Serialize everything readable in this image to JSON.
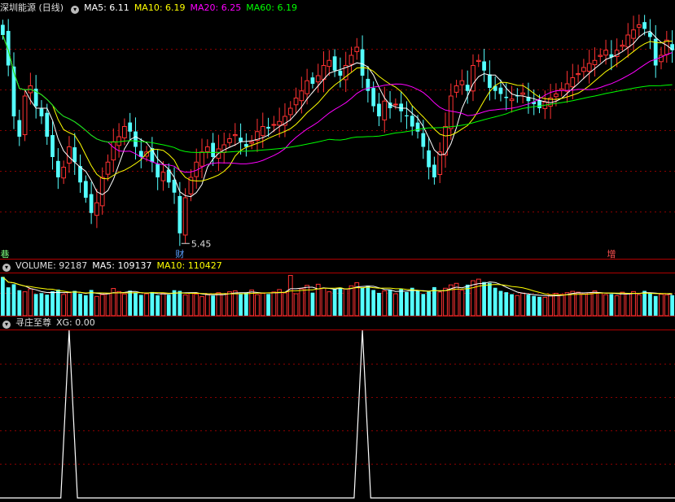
{
  "header": {
    "title": "深圳能源 (日线)",
    "ma5_label": "MA5: 6.11",
    "ma10_label": "MA10: 6.19",
    "ma20_label": "MA20: 6.25",
    "ma60_label": "MA60: 6.19"
  },
  "volume_header": {
    "title": "VOLUME: 92187",
    "ma5_label": "MA5: 109137",
    "ma10_label": "MA10: 110427"
  },
  "indicator_header": {
    "title": "寻庄至尊",
    "xg_label": "XG: 0.00"
  },
  "colors": {
    "up": "#ff3232",
    "down": "#54ffff",
    "ma5": "#ffffff",
    "ma10": "#ffff00",
    "ma20": "#ff00ff",
    "ma60": "#00ff00",
    "grid": "#8b0000",
    "background": "#000000"
  },
  "chart_data": [
    {
      "type": "candlestick",
      "low_marker": {
        "label": "5.45",
        "value": 5.45
      },
      "event_markers": [
        {
          "label": "巷",
          "index": 0
        },
        {
          "label": "财",
          "index": 32
        },
        {
          "label": "增",
          "index": 110
        }
      ],
      "ylim": [
        5.3,
        7.7
      ],
      "close": [
        7.5,
        7.2,
        6.7,
        6.5,
        6.9,
        7.0,
        6.8,
        6.7,
        6.5,
        6.3,
        6.1,
        6.2,
        6.4,
        6.25,
        6.05,
        5.9,
        5.75,
        5.85,
        6.1,
        6.25,
        6.45,
        6.5,
        6.6,
        6.55,
        6.4,
        6.3,
        6.35,
        6.25,
        6.1,
        6.15,
        6.05,
        5.95,
        5.55,
        5.9,
        6.1,
        6.25,
        6.35,
        6.4,
        6.3,
        6.38,
        6.42,
        6.48,
        6.52,
        6.45,
        6.4,
        6.45,
        6.55,
        6.6,
        6.58,
        6.62,
        6.65,
        6.7,
        6.78,
        6.88,
        6.95,
        7.05,
        7.02,
        7.1,
        7.2,
        7.25,
        7.15,
        7.1,
        7.2,
        7.3,
        7.38,
        7.1,
        6.95,
        6.8,
        6.7,
        6.85,
        6.78,
        6.82,
        6.75,
        6.7,
        6.6,
        6.55,
        6.4,
        6.2,
        6.1,
        6.35,
        6.6,
        6.9,
        7.0,
        7.05,
        6.95,
        7.2,
        7.25,
        7.15,
        6.98,
        6.95,
        6.92,
        6.88,
        6.87,
        6.9,
        6.93,
        6.85,
        6.82,
        6.78,
        6.84,
        6.88,
        6.92,
        6.97,
        7.02,
        7.08,
        7.12,
        7.18,
        7.22,
        7.25,
        7.3,
        7.35,
        7.28,
        7.35,
        7.4,
        7.5,
        7.55,
        7.6,
        7.56,
        7.48,
        7.2,
        7.3,
        7.45,
        7.35
      ],
      "volume": [
        175000,
        128000,
        142000,
        115000,
        108000,
        121000,
        98000,
        102000,
        95000,
        110000,
        118000,
        96000,
        104000,
        112000,
        99000,
        92000,
        116000,
        87000,
        95000,
        101000,
        123000,
        109000,
        98000,
        113000,
        105000,
        94000,
        99000,
        107000,
        92000,
        101000,
        95000,
        115000,
        112000,
        94000,
        103000,
        98000,
        86000,
        95000,
        91000,
        104000,
        99000,
        108000,
        112000,
        97000,
        104000,
        116000,
        95000,
        101000,
        98000,
        107000,
        118000,
        103000,
        182000,
        99000,
        121000,
        137000,
        104000,
        142000,
        125000,
        108000,
        119000,
        127000,
        121000,
        135000,
        149000,
        127000,
        136000,
        116000,
        103000,
        112000,
        118000,
        99000,
        121000,
        107000,
        126000,
        113000,
        98000,
        109000,
        129000,
        107000,
        124000,
        139000,
        146000,
        115000,
        140000,
        158000,
        165000,
        152000,
        148000,
        126000,
        112000,
        106000,
        97000,
        91000,
        102000,
        95000,
        89000,
        85000,
        83000,
        93000,
        101000,
        96000,
        104000,
        110000,
        106000,
        98000,
        103000,
        112000,
        102000,
        95000,
        98000,
        90000,
        106000,
        99000,
        109000,
        95000,
        112000,
        104000,
        89000,
        97000,
        94000,
        92187
      ]
    },
    {
      "type": "line",
      "series": [
        {
          "name": "XG",
          "spikes": [
            {
              "index": 12,
              "value": 1
            },
            {
              "index": 65,
              "value": 1
            }
          ]
        }
      ]
    }
  ]
}
